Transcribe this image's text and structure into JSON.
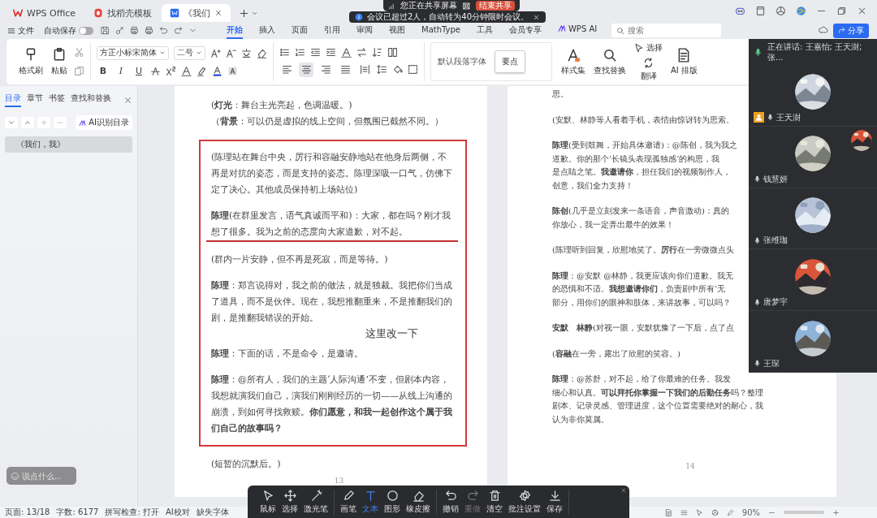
{
  "title_bar": {
    "tabs": [
      {
        "label": "WPS Office",
        "selected": false
      },
      {
        "label": "找稻壳模板",
        "selected": false
      },
      {
        "label": "《我们",
        "selected": true
      }
    ]
  },
  "screen_share": {
    "status": "您正在共享屏幕",
    "stop_button": "结束共享"
  },
  "notice": {
    "text": "会议已超过2人，自动转为40分钟限时会议。"
  },
  "menu_bar": {
    "file": "文件",
    "autosave": {
      "label": "自动保存",
      "on": false
    },
    "tabs": [
      {
        "label": "开始",
        "selected": true
      },
      {
        "label": "插入",
        "selected": false
      },
      {
        "label": "页面",
        "selected": false
      },
      {
        "label": "引用",
        "selected": false
      },
      {
        "label": "审阅",
        "selected": false
      },
      {
        "label": "视图",
        "selected": false
      },
      {
        "label": "MathType",
        "selected": false
      },
      {
        "label": "工具",
        "selected": false
      },
      {
        "label": "会员专享",
        "selected": false
      },
      {
        "label": "WPS AI",
        "selected": false
      }
    ],
    "search": {
      "placeholder": "搜索"
    },
    "share_button": "分享"
  },
  "ribbon": {
    "clipboard": [
      "格式刷",
      "粘贴"
    ],
    "font": {
      "family": "方正小标宋简体",
      "size": "二号",
      "styles": [
        "B",
        "I",
        "U"
      ]
    },
    "paragraph": {
      "align_buttons": [
        {
          "selected": false
        },
        {
          "selected": true
        },
        {
          "selected": false
        },
        {
          "selected": false
        },
        {
          "selected": false
        }
      ]
    },
    "style_gallery": [
      {
        "label": "默认段落字体",
        "selected": false
      },
      {
        "label": "要点",
        "selected": true
      }
    ],
    "tools": [
      "样式集",
      "查找替换",
      "选择",
      "翻译",
      "AI 排版"
    ]
  },
  "navigation": {
    "tabs": [
      {
        "label": "目录",
        "selected": true
      },
      {
        "label": "章节",
        "selected": false
      },
      {
        "label": "书签",
        "selected": false
      },
      {
        "label": "查找和替换",
        "selected": false
      }
    ],
    "ai_button": "AI识别目录",
    "items": [
      {
        "label": "《我们，我》",
        "selected": true
      }
    ]
  },
  "left_page": {
    "intro": [
      "(**灯光**：舞台主光亮起，色调温暖。)",
      "（**背景**：可以仍是虚拟的线上空间，但氛围已截然不同。）"
    ],
    "box": {
      "paragraphs": [
        {
          "text": "(陈理站在舞台中央，厉行和容融安静地站在他身后两侧，不再是对抗的姿态，而是支持的姿态。陈理深吸一口气，仿佛下定了决心。其他成员保持初上场站位)",
          "underlined": false
        },
        {
          "text": "**陈理**(在群里发言，语气真诚而平和)：大家，都在吗？刚才我想了很多。我为之前的态度向大家道歉，对不起。",
          "underlined": true
        },
        {
          "text": "(群内一片安静，但不再是死寂，而是等待。)",
          "underlined": false
        },
        {
          "text": "**陈理**：郑言说得对，我之前的做法，就是独裁。我把你们当成了道具，而不是伙伴。现在，我想推翻重来，不是推翻我们的剧，是推翻我错误的开始。",
          "underlined": false
        },
        {
          "text": "**陈理**：下面的话，不是命令，是邀请。",
          "underlined": false
        },
        {
          "text": "**陈理**：@所有人，我们的主题‘人际沟通’不变，但剧本内容，我想就演我们自己，演我们刚刚经历的一切——从线上沟通的崩溃，到如何寻找救赎。**你们愿意，和我一起创作这个属于我们自己的故事吗？**",
          "underlined": false
        }
      ],
      "note": "这里改一下"
    },
    "outro": [
      "(短暂的沉默后。)"
    ],
    "page_number": "13"
  },
  "right_page": {
    "paragraphs": [
      [
        "思。"
      ],
      [
        "(安默、林静等人看着手机，表情由惊讶转为思索。"
      ],
      [
        "**陈理**(受到鼓舞，开始具体邀请)：@陈创，我为我之",
        "道歉。你的那个‘长镜头表现孤独感’的构思，我",
        "是点睛之笔。**我邀请你**，担任我们的视频制作人，",
        "创意，我们全力支持！"
      ],
      [
        "**陈创**(几乎是立刻发来一条语音，声音激动)：真的",
        "你放心，我一定弄出最牛的效果！"
      ],
      [
        "(陈理听到回复，欣慰地笑了。**厉行**在一旁微微点头"
      ],
      [
        "**陈理**：@安默 @林静，我更应该向你们道歉。我无",
        "的恐惧和不适。**我想邀请你们**，负责剧中所有‘无",
        "部分，用你们的眼神和肢体，来讲故事，可以吗？"
      ],
      [
        "**安默　林静**(对视一眼，安默犹豫了一下后，点了点"
      ],
      [
        "(**容融**在一旁，露出了欣慰的笑容。)"
      ],
      [
        "**陈理**：@苏舒，对不起，给了你最难的任务。我发",
        "细心和认真。**可以拜托你掌握一下我们的后勤任务**吗？整理",
        "剧本、记录灵感、管理进度，这个位置需要绝对的耐心，我",
        "认为非你莫属。"
      ]
    ],
    "page_number": "14"
  },
  "video_panel": {
    "speaking": "正在讲话: 王嘉怡; 王天澍; 张...",
    "participants": [
      {
        "name": "王天澍",
        "host": true
      },
      {
        "name": "钱慧妍",
        "host": false
      },
      {
        "name": "张维珈",
        "host": false
      },
      {
        "name": "唐梦宇",
        "host": false
      },
      {
        "name": "王琛",
        "host": false
      }
    ]
  },
  "comment_input": {
    "placeholder": "说点什么..."
  },
  "annotation_toolbar": {
    "groups": [
      [
        {
          "label": "鼠标",
          "selected": false,
          "disabled": false
        },
        {
          "label": "选择",
          "selected": false,
          "disabled": false
        },
        {
          "label": "激光笔",
          "selected": false,
          "disabled": false
        }
      ],
      [
        {
          "label": "画笔",
          "selected": false,
          "disabled": false
        },
        {
          "label": "文本",
          "selected": true,
          "disabled": false
        },
        {
          "label": "图形",
          "selected": false,
          "disabled": false
        },
        {
          "label": "橡皮擦",
          "selected": false,
          "disabled": false
        }
      ],
      [
        {
          "label": "撤销",
          "selected": false,
          "disabled": false
        },
        {
          "label": "重做",
          "selected": false,
          "disabled": true
        },
        {
          "label": "清空",
          "selected": false,
          "disabled": false
        },
        {
          "label": "批注设置",
          "selected": false,
          "disabled": false
        },
        {
          "label": "保存",
          "selected": false,
          "disabled": false
        }
      ]
    ]
  },
  "status_bar": {
    "items": [
      "页面: 13/18",
      "字数: 6177",
      "拼写检查: 打开",
      "AI校对",
      "缺失字体"
    ],
    "zoom": "90%"
  }
}
